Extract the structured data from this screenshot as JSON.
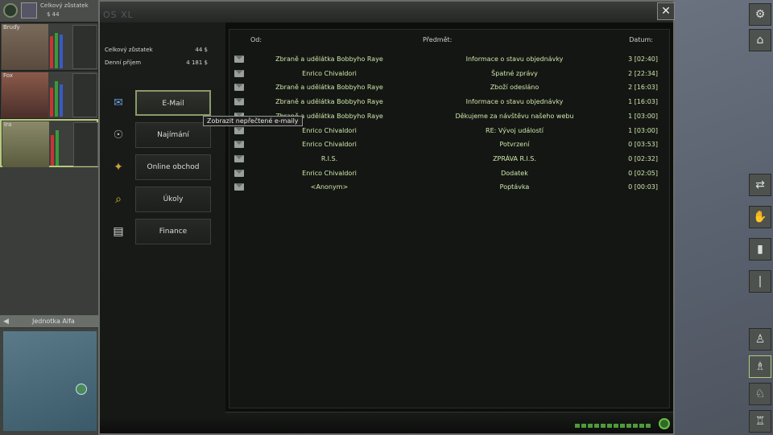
{
  "hud": {
    "balance_label": "Celkový zůstatek",
    "balance_value": "$ 44"
  },
  "mercs": [
    {
      "name": "Bruďy"
    },
    {
      "name": "Fox"
    },
    {
      "name": "Ira"
    }
  ],
  "squad": {
    "title": "Jednotka Alfa"
  },
  "laptop": {
    "logo": "OS XL",
    "close_label": "✕"
  },
  "summary": {
    "balance_label": "Celkový zůstatek",
    "balance_value": "44 $",
    "income_label": "Denní příjem",
    "income_value": "4 181 $"
  },
  "nav": [
    {
      "label": "E-Mail",
      "icon": "email-icon",
      "glyph": "✉"
    },
    {
      "label": "Najímání",
      "icon": "hire-icon",
      "glyph": "☉"
    },
    {
      "label": "Online obchod",
      "icon": "shop-icon",
      "glyph": "✦"
    },
    {
      "label": "Úkoly",
      "icon": "tasks-icon",
      "glyph": "⌕"
    },
    {
      "label": "Finance",
      "icon": "finance-icon",
      "glyph": "▤"
    }
  ],
  "tooltip": "Zobrazit nepřečtené e-maily",
  "inbox": {
    "col_from": "Od:",
    "col_subject": "Předmět:",
    "col_date": "Datum:",
    "rows": [
      {
        "from": "Zbraně a udělátka Bobbyho Raye",
        "subject": "Informace o stavu objednávky",
        "date": "3 [02:40]"
      },
      {
        "from": "Enrico Chivaldori",
        "subject": "Špatné zprávy",
        "date": "2 [22:34]"
      },
      {
        "from": "Zbraně a udělátka Bobbyho Raye",
        "subject": "Zboží odesláno",
        "date": "2 [16:03]"
      },
      {
        "from": "Zbraně a udělátka Bobbyho Raye",
        "subject": "Informace o stavu objednávky",
        "date": "1 [16:03]"
      },
      {
        "from": "Zbraně a udělátka Bobbyho Raye",
        "subject": "Děkujeme za návštěvu našeho webu",
        "date": "1 [03:00]"
      },
      {
        "from": "Enrico Chivaldori",
        "subject": "RE: Vývoj událostí",
        "date": "1 [03:00]"
      },
      {
        "from": "Enrico Chivaldori",
        "subject": "Potvrzení",
        "date": "0 [03:53]"
      },
      {
        "from": "R.I.S.",
        "subject": "ZPRÁVA R.I.S.",
        "date": "0 [02:32]"
      },
      {
        "from": "Enrico Chivaldori",
        "subject": "Dodatek",
        "date": "0 [02:05]"
      },
      {
        "from": "<Anonym>",
        "subject": "Poptávka",
        "date": "0 [00:03]"
      }
    ]
  },
  "right_buttons": [
    {
      "icon": "settings-icon",
      "glyph": "⚙"
    },
    {
      "icon": "hat-icon",
      "glyph": "⌂"
    },
    {
      "icon": "swap-icon",
      "glyph": "⇄"
    },
    {
      "icon": "hand-icon",
      "glyph": "✋"
    },
    {
      "icon": "door-icon",
      "glyph": "▮"
    },
    {
      "icon": "bar-icon",
      "glyph": "|"
    },
    {
      "icon": "stance-stand-icon",
      "glyph": "♙"
    },
    {
      "icon": "stance-walk-icon",
      "glyph": "♗"
    },
    {
      "icon": "stance-crouch-icon",
      "glyph": "♘"
    },
    {
      "icon": "stance-prone-icon",
      "glyph": "♖"
    }
  ]
}
